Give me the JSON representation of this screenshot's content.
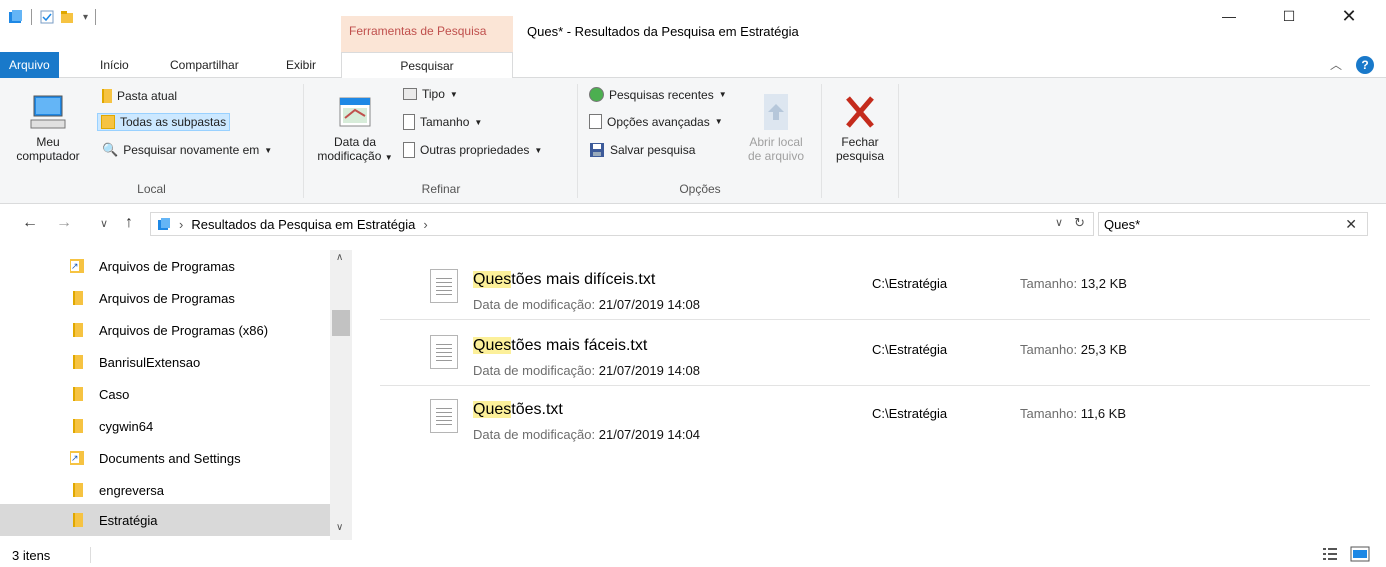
{
  "window": {
    "title": "Ques* - Resultados da Pesquisa em Estratégia",
    "context_tab_title": "Ferramentas de Pesquisa"
  },
  "tabs": [
    {
      "label": "Arquivo"
    },
    {
      "label": "Início"
    },
    {
      "label": "Compartilhar"
    },
    {
      "label": "Exibir"
    },
    {
      "label": "Pesquisar"
    }
  ],
  "ribbon": {
    "local": {
      "meu_computador": "Meu computador",
      "pasta_atual": "Pasta atual",
      "todas_subpastas": "Todas as subpastas",
      "pesquisar_novamente": "Pesquisar novamente em",
      "label": "Local"
    },
    "refinar": {
      "data_modificacao": "Data da modificação",
      "tipo": "Tipo",
      "tamanho": "Tamanho",
      "outras_propriedades": "Outras propriedades",
      "label": "Refinar"
    },
    "opcoes": {
      "pesquisas_recentes": "Pesquisas recentes",
      "opcoes_avancadas": "Opções avançadas",
      "salvar_pesquisa": "Salvar pesquisa",
      "abrir_local": "Abrir local de arquivo",
      "label": "Opções"
    },
    "fechar": {
      "label": "Fechar pesquisa"
    }
  },
  "address": {
    "path": "Resultados da Pesquisa em Estratégia",
    "search_value": "Ques*"
  },
  "nav": {
    "items": [
      {
        "label": "Arquivos de Programas",
        "kind": "shortcut"
      },
      {
        "label": "Arquivos de Programas",
        "kind": "folder"
      },
      {
        "label": "Arquivos de Programas (x86)",
        "kind": "folder"
      },
      {
        "label": "BanrisulExtensao",
        "kind": "folder"
      },
      {
        "label": "Caso",
        "kind": "folder"
      },
      {
        "label": "cygwin64",
        "kind": "folder"
      },
      {
        "label": "Documents and Settings",
        "kind": "shortcut"
      },
      {
        "label": "engreversa",
        "kind": "folder"
      },
      {
        "label": "Estratégia",
        "kind": "folder",
        "selected": true
      }
    ]
  },
  "results": {
    "date_label": "Data de modificação:",
    "size_label": "Tamanho:",
    "items": [
      {
        "match": "Ques",
        "rest": "tões mais difíceis.txt",
        "date": "21/07/2019 14:08",
        "location": "C:\\Estratégia",
        "size": "13,2 KB"
      },
      {
        "match": "Ques",
        "rest": "tões mais fáceis.txt",
        "date": "21/07/2019 14:08",
        "location": "C:\\Estratégia",
        "size": "25,3 KB"
      },
      {
        "match": "Ques",
        "rest": "tões.txt",
        "date": "21/07/2019 14:04",
        "location": "C:\\Estratégia",
        "size": "11,6 KB"
      }
    ]
  },
  "status": {
    "count": "3 itens"
  },
  "colors": {
    "file_tab": "#1979ca",
    "context_tab": "#fbe5d6",
    "highlight": "#fcf09a",
    "close_x": "#c42b1c"
  }
}
